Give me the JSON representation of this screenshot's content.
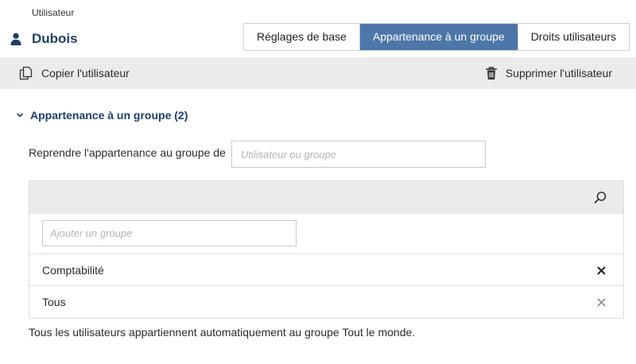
{
  "header": {
    "breadcrumb": "Utilisateur",
    "user_name": "Dubois",
    "tabs": [
      {
        "label": "Réglages de base",
        "active": false
      },
      {
        "label": "Appartenance à un groupe",
        "active": true
      },
      {
        "label": "Droits utilisateurs",
        "active": false
      }
    ]
  },
  "toolbar": {
    "copy_label": "Copier l'utilisateur",
    "delete_label": "Supprimer l'utilisateur"
  },
  "section": {
    "title": "Appartenance à un groupe (2)",
    "inherit_label": "Reprendre l'appartenance au groupe de",
    "inherit_placeholder": "Utilisateur ou groupe",
    "add_placeholder": "Ajouter un groupe",
    "groups": [
      {
        "name": "Comptabilité",
        "removable": true
      },
      {
        "name": "Tous",
        "removable": false
      }
    ],
    "note": "Tous les utilisateurs appartiennent automatiquement au groupe Tout le monde."
  },
  "icons": {
    "user": "user-icon",
    "copy": "copy-icon",
    "delete": "trash-icon",
    "collapse": "chevron-down-icon",
    "search": "search-icon",
    "remove": "close-icon"
  },
  "colors": {
    "accent": "#4d77a8",
    "title": "#1f3f66",
    "toolbar_bg": "#ebebeb",
    "remove_active": "#222222",
    "remove_disabled": "#8a8a8a"
  }
}
